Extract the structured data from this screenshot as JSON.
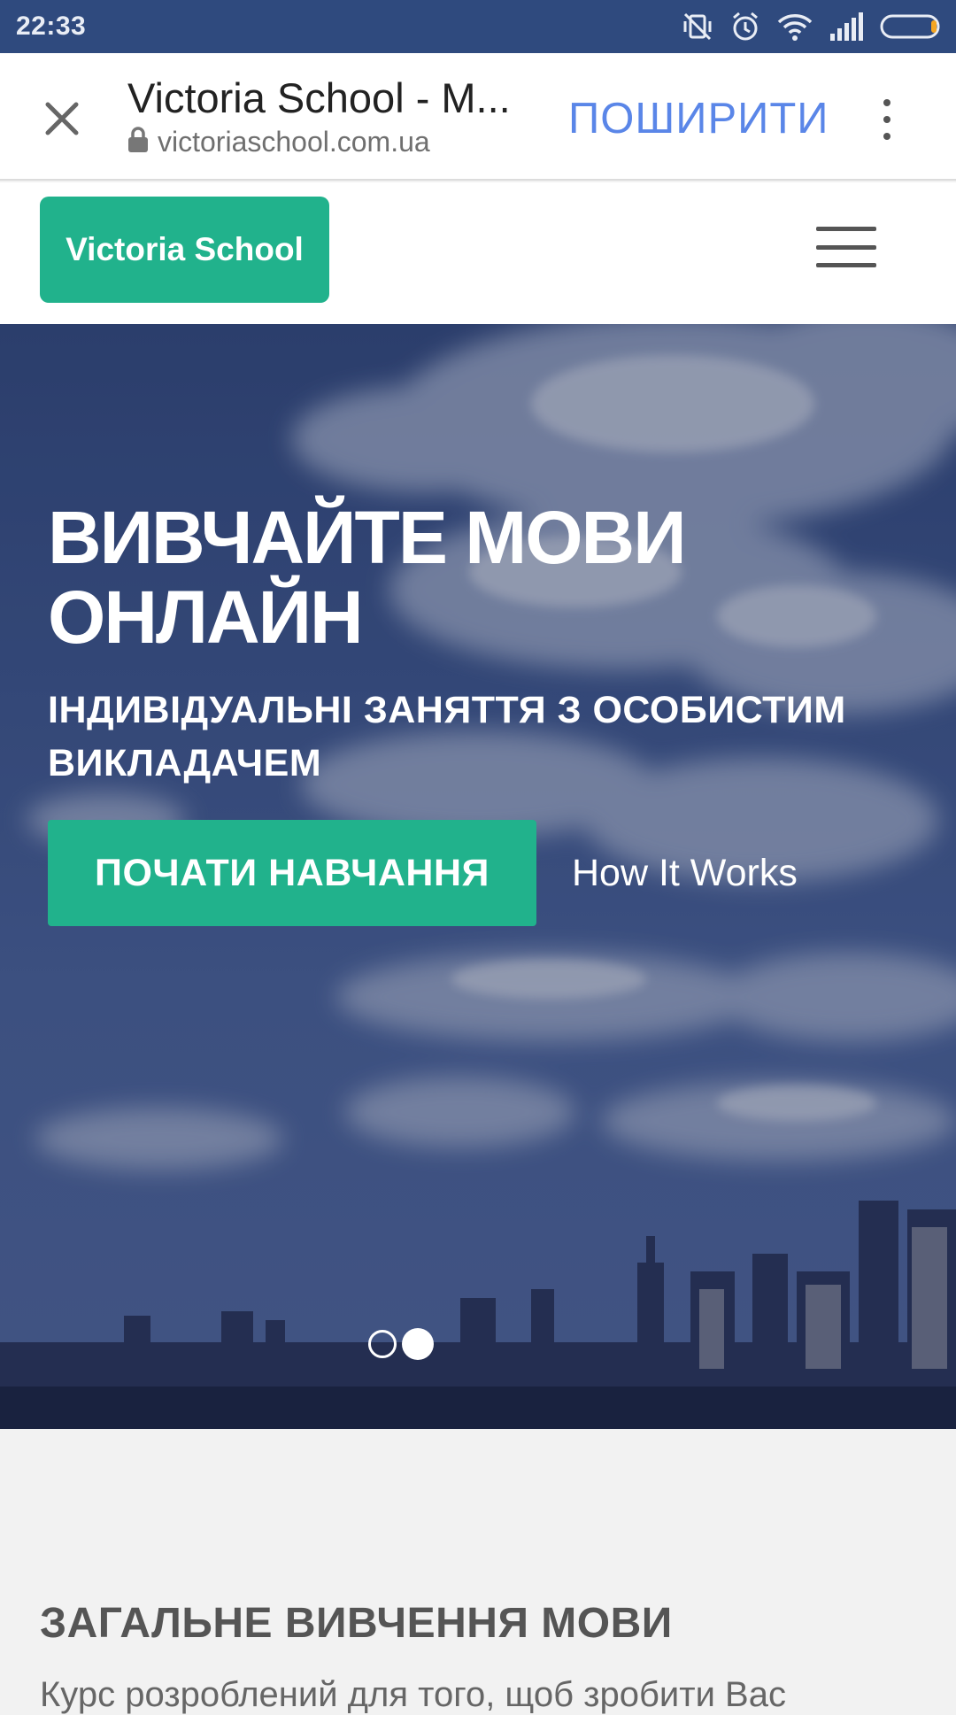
{
  "status_bar": {
    "time": "22:33",
    "icons": [
      "vibrate-off-icon",
      "alarm-icon",
      "wifi-icon",
      "signal-icon",
      "battery-icon"
    ]
  },
  "toolbar": {
    "title": "Victoria School - М...",
    "url": "victoriaschool.com.ua",
    "share_label": "ПОШИРИТИ",
    "accent": "#5a86e8"
  },
  "header": {
    "logo_label": "Victoria School",
    "brand_color": "#21b28c"
  },
  "hero": {
    "title": "ВИВЧАЙТЕ МОВИ ОНЛАЙН",
    "subtitle": "ІНДИВІДУАЛЬНІ ЗАНЯТТЯ З ОСОБИСТИМ ВИКЛАДАЧЕМ",
    "cta_label": "ПОЧАТИ НАВЧАННЯ",
    "secondary_link": "How It Works",
    "slides_total": 2,
    "active_slide": 2
  },
  "section": {
    "heading": "ЗАГАЛЬНЕ ВИВЧЕННЯ МОВИ",
    "text": "Курс розроблений для того, щоб зробити Вас"
  }
}
